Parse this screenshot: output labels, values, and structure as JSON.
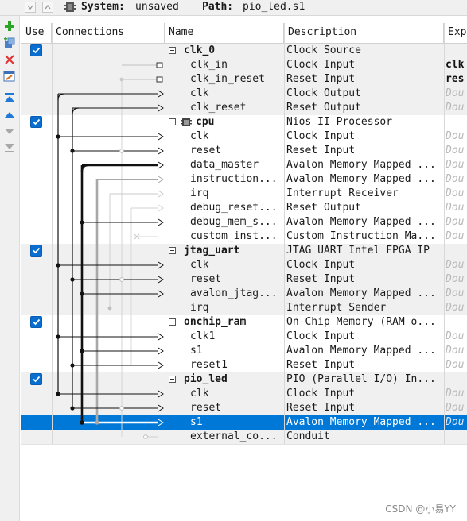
{
  "toolbar": {
    "system_label": "System:",
    "system_value": "unsaved",
    "path_label": "Path:",
    "path_value": "pio_led.s1"
  },
  "columns": {
    "use": "Use",
    "connections": "Connections",
    "name": "Name",
    "description": "Description",
    "export": "Exp"
  },
  "rows": [
    {
      "kind": "module",
      "checked": true,
      "name": "clk_0",
      "description": "Clock Source",
      "export": ""
    },
    {
      "kind": "iface",
      "name": "clk_in",
      "description": "Clock Input",
      "export": "clk",
      "export_bold": true
    },
    {
      "kind": "iface",
      "name": "clk_in_reset",
      "description": "Reset Input",
      "export": "res",
      "export_bold": true
    },
    {
      "kind": "iface",
      "name": "clk",
      "description": "Clock Output",
      "export": "Dou"
    },
    {
      "kind": "iface",
      "name": "clk_reset",
      "description": "Reset Output",
      "export": "Dou"
    },
    {
      "kind": "module",
      "checked": true,
      "icon": "cpu-chip-icon",
      "name": "cpu",
      "description": "Nios II Processor",
      "export": ""
    },
    {
      "kind": "iface",
      "name": "clk",
      "description": "Clock Input",
      "export": "Dou"
    },
    {
      "kind": "iface",
      "name": "reset",
      "description": "Reset Input",
      "export": "Dou"
    },
    {
      "kind": "iface",
      "name": "data_master",
      "description": "Avalon Memory Mapped ...",
      "export": "Dou"
    },
    {
      "kind": "iface",
      "name": "instruction...",
      "description": "Avalon Memory Mapped ...",
      "export": "Dou"
    },
    {
      "kind": "iface",
      "name": "irq",
      "description": "Interrupt Receiver",
      "export": "Dou"
    },
    {
      "kind": "iface",
      "name": "debug_reset...",
      "description": "Reset Output",
      "export": "Dou"
    },
    {
      "kind": "iface",
      "name": "debug_mem_s...",
      "description": "Avalon Memory Mapped ...",
      "export": "Dou"
    },
    {
      "kind": "iface",
      "name": "custom_inst...",
      "description": "Custom Instruction Ma...",
      "export": "Dou"
    },
    {
      "kind": "module",
      "checked": true,
      "name": "jtag_uart",
      "description": "JTAG UART Intel FPGA IP",
      "export": ""
    },
    {
      "kind": "iface",
      "name": "clk",
      "description": "Clock Input",
      "export": "Dou"
    },
    {
      "kind": "iface",
      "name": "reset",
      "description": "Reset Input",
      "export": "Dou"
    },
    {
      "kind": "iface",
      "name": "avalon_jtag...",
      "description": "Avalon Memory Mapped ...",
      "export": "Dou"
    },
    {
      "kind": "iface",
      "name": "irq",
      "description": "Interrupt Sender",
      "export": "Dou"
    },
    {
      "kind": "module",
      "checked": true,
      "name": "onchip_ram",
      "description": "On-Chip Memory (RAM o...",
      "export": ""
    },
    {
      "kind": "iface",
      "name": "clk1",
      "description": "Clock Input",
      "export": "Dou"
    },
    {
      "kind": "iface",
      "name": "s1",
      "description": "Avalon Memory Mapped ...",
      "export": "Dou"
    },
    {
      "kind": "iface",
      "name": "reset1",
      "description": "Reset Input",
      "export": "Dou"
    },
    {
      "kind": "module",
      "checked": true,
      "name": "pio_led",
      "description": "PIO (Parallel I/O) In...",
      "export": ""
    },
    {
      "kind": "iface",
      "name": "clk",
      "description": "Clock Input",
      "export": "Dou"
    },
    {
      "kind": "iface",
      "name": "reset",
      "description": "Reset Input",
      "export": "Dou"
    },
    {
      "kind": "iface",
      "name": "s1",
      "description": "Avalon Memory Mapped ...",
      "export": "Dou",
      "selected": true
    },
    {
      "kind": "iface",
      "name": "external_co...",
      "description": "Conduit",
      "export": ""
    }
  ],
  "watermark": "CSDN @小易YY",
  "colors": {
    "selection": "#0078d7",
    "checkbox": "#0a6ed1",
    "shade": "#f0f0f0"
  }
}
